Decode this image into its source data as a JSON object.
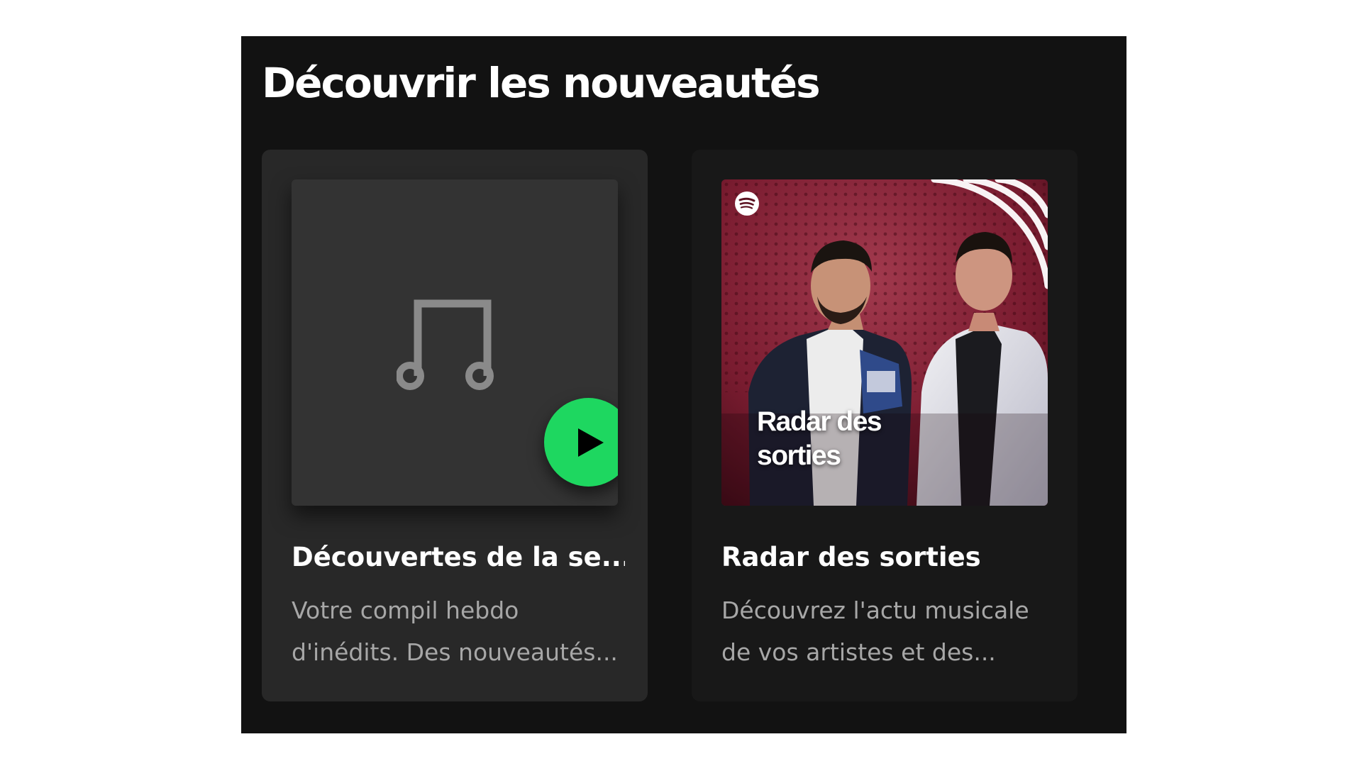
{
  "section": {
    "title": "Découvrir les nouveautés"
  },
  "cards": [
    {
      "title": "Découvertes de la se...",
      "desc_line1": "Votre compil hebdo",
      "desc_line2": "d'inédits. Des nouveautés...",
      "cover_icon": "music-note-icon",
      "action_icon": "play-icon"
    },
    {
      "title": "Radar des sorties",
      "desc_line1": "Découvrez l'actu musicale",
      "desc_line2": "de vos artistes et des...",
      "cover_text_line1": "Radar des",
      "cover_text_line2": "sorties",
      "cover_icon": "spotify-logo-icon"
    }
  ],
  "colors": {
    "panel_background": "#121212",
    "card_hover_background": "#282828",
    "card_background": "#181818",
    "accent_green": "#1ed760",
    "secondary_text": "#a7a7a7"
  }
}
